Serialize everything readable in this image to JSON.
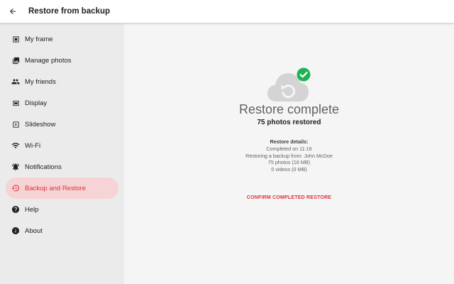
{
  "appbar": {
    "title": "Restore from backup",
    "back_icon": "arrow-back-icon"
  },
  "sidebar": {
    "items": [
      {
        "label": "My frame",
        "icon": "frame-icon",
        "active": false
      },
      {
        "label": "Manage photos",
        "icon": "photo-library-icon",
        "active": false
      },
      {
        "label": "My friends",
        "icon": "people-icon",
        "active": false
      },
      {
        "label": "Display",
        "icon": "display-icon",
        "active": false
      },
      {
        "label": "Slideshow",
        "icon": "slideshow-icon",
        "active": false
      },
      {
        "label": "Wi-Fi",
        "icon": "wifi-icon",
        "active": false
      },
      {
        "label": "Notifications",
        "icon": "bell-icon",
        "active": false
      },
      {
        "label": "Backup and Restore",
        "icon": "restore-icon",
        "active": true
      },
      {
        "label": "Help",
        "icon": "help-icon",
        "active": false
      },
      {
        "label": "About",
        "icon": "info-icon",
        "active": false
      }
    ]
  },
  "main": {
    "status_icon": "cloud-restore-icon",
    "check_icon": "check-circle-icon",
    "title": "Restore complete",
    "subtitle": "75 photos restored",
    "details": {
      "heading": "Restore details:",
      "lines": [
        "Completed on 11:16",
        "Restoring a backup from: John McDoe",
        "75 photos (16 MB)",
        "0 videos (0 MB)"
      ]
    },
    "confirm_label": "CONFIRM COMPLETED RESTORE"
  },
  "colors": {
    "accent": "#e0303f",
    "active_bg": "#f6d3d5",
    "sidebar_bg": "#ebebeb",
    "success": "#1fb254",
    "cloud": "#d4d4d4"
  }
}
